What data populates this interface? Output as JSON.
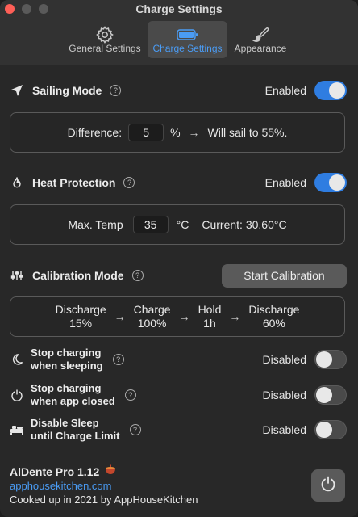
{
  "window": {
    "title": "Charge Settings"
  },
  "tabs": [
    {
      "label": "General Settings",
      "icon": "gear-icon"
    },
    {
      "label": "Charge Settings",
      "icon": "battery-icon",
      "active": true
    },
    {
      "label": "Appearance",
      "icon": "paintbrush-icon"
    }
  ],
  "sailing": {
    "title": "Sailing Mode",
    "status": "Enabled",
    "enabled": true,
    "difference_label": "Difference:",
    "difference_value": "5",
    "unit": "%",
    "arrow": "→",
    "result": "Will sail to 55%."
  },
  "heat": {
    "title": "Heat Protection",
    "status": "Enabled",
    "enabled": true,
    "max_label": "Max. Temp",
    "max_value": "35",
    "unit": "°C",
    "current": "Current: 30.60°C"
  },
  "calibration": {
    "title": "Calibration Mode",
    "button": "Start Calibration",
    "steps": [
      {
        "line1": "Discharge",
        "line2": "15%"
      },
      {
        "line1": "Charge",
        "line2": "100%"
      },
      {
        "line1": "Hold",
        "line2": "1h"
      },
      {
        "line1": "Discharge",
        "line2": "60%"
      }
    ],
    "arrow": "→"
  },
  "options": [
    {
      "line1": "Stop charging",
      "line2": "when sleeping",
      "status": "Disabled",
      "icon": "moon-icon"
    },
    {
      "line1": "Stop charging",
      "line2": "when app closed",
      "status": "Disabled",
      "icon": "power-icon"
    },
    {
      "line1": "Disable Sleep",
      "line2": "until Charge Limit",
      "status": "Disabled",
      "icon": "bed-icon"
    }
  ],
  "footer": {
    "app_name": "AlDente Pro 1.12",
    "link": "apphousekitchen.com",
    "credit": "Cooked up in 2021 by AppHouseKitchen"
  },
  "colors": {
    "accent": "#2f7de1",
    "link": "#4a9cf5",
    "close": "#fe5f57"
  }
}
